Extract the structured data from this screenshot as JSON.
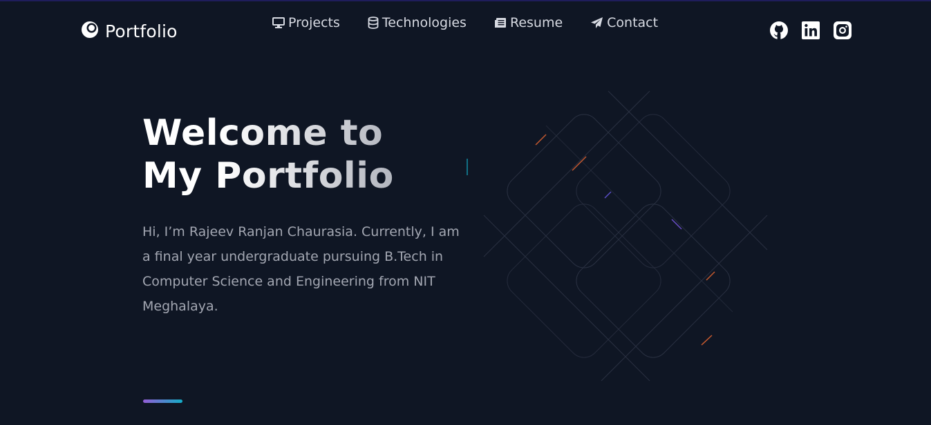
{
  "header": {
    "logo_text": "Portfolio",
    "nav": [
      {
        "label": "Projects",
        "icon": "monitor-icon"
      },
      {
        "label": "Technologies",
        "icon": "database-icon"
      },
      {
        "label": "Resume",
        "icon": "newspaper-icon"
      },
      {
        "label": "Contact",
        "icon": "paper-plane-icon"
      }
    ],
    "social": [
      {
        "name": "github-icon"
      },
      {
        "name": "linkedin-icon"
      },
      {
        "name": "instagram-icon"
      }
    ]
  },
  "hero": {
    "title_line1": "Welcome to",
    "title_line2": "My Portfolio",
    "description": "Hi, I’m Rajeev Ranjan Chaurasia. Currently, I am a final year undergraduate pursuing B.Tech in Computer Science and Engineering from NIT Meghalaya."
  },
  "colors": {
    "background": "#0f1624",
    "accent_start": "#945dd6",
    "accent_end": "#13adc7",
    "nav_text": "#d8dbe3",
    "desc_text": "#a3a7b2"
  }
}
